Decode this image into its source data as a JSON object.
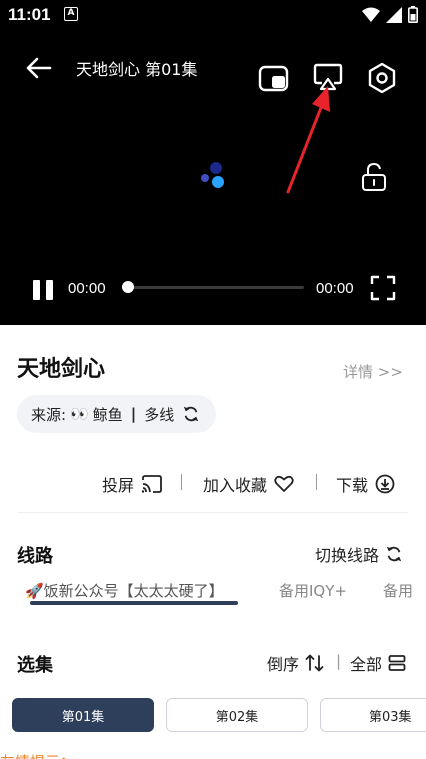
{
  "status_bar": {
    "time": "11:01",
    "app_icon_letter": "A",
    "icons": [
      "wifi-icon",
      "signal-icon",
      "battery-icon"
    ]
  },
  "player": {
    "title": "天地剑心 第01集",
    "current_time": "00:00",
    "duration": "00:00",
    "progress": 0,
    "icons": [
      "back-arrow-icon",
      "pip-icon",
      "cast-screen-icon",
      "settings-hex-icon",
      "unlock-icon",
      "pause-icon",
      "fullscreen-icon"
    ]
  },
  "show": {
    "title": "天地剑心",
    "details_link": "详情 >>",
    "source_label": "来源:",
    "source_emoji": "👀",
    "source_name": "鲸鱼",
    "source_sep": "|",
    "source_mode": "多线"
  },
  "actions": {
    "cast": "投屏",
    "favorite": "加入收藏",
    "download": "下载"
  },
  "routes": {
    "heading": "线路",
    "switch_label": "切换线路",
    "items": [
      {
        "label": "🚀饭新公众号【太太太硬了】",
        "selected": true
      },
      {
        "label": "备用IQY+",
        "selected": false
      },
      {
        "label": "备用",
        "selected": false
      }
    ]
  },
  "episodes": {
    "heading": "选集",
    "sort_label": "倒序",
    "sep": "|",
    "all_label": "全部",
    "items": [
      {
        "label": "第01集",
        "active": true
      },
      {
        "label": "第02集",
        "active": false
      },
      {
        "label": "第03集",
        "active": false
      }
    ]
  },
  "footer_hint": "友情提示：",
  "colors": {
    "accent": "#2e3f5b",
    "annotation_arrow": "#e8232c",
    "hint": "#e8862e",
    "loading_dots": [
      "#1a2a8c",
      "#3f4ec2",
      "#29a3ff"
    ]
  }
}
